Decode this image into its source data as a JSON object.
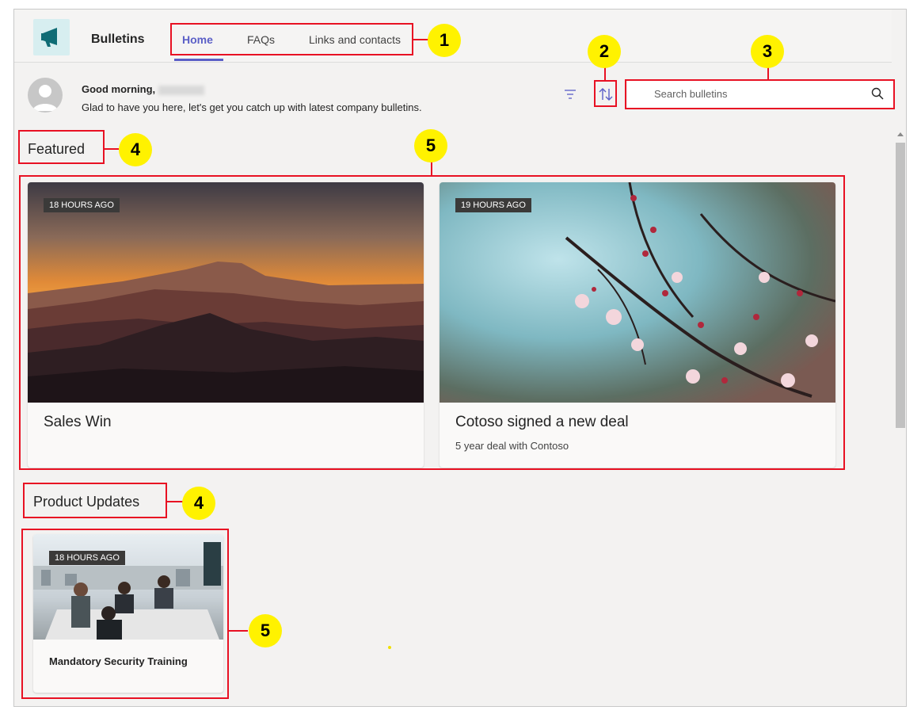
{
  "app": {
    "title": "Bulletins",
    "colors": {
      "accent": "#5b5fc7",
      "annotation": "#e81123",
      "callout": "#fff200"
    }
  },
  "tabs": [
    {
      "label": "Home",
      "active": true
    },
    {
      "label": "FAQs",
      "active": false
    },
    {
      "label": "Links and contacts",
      "active": false
    }
  ],
  "greeting": {
    "title": "Good morning,",
    "subtitle": "Glad to have you here, let's get you catch up with latest company bulletins."
  },
  "toolbar": {
    "filter_icon": "filter-icon",
    "sort_icon": "sort-icon"
  },
  "search": {
    "placeholder": "Search bulletins"
  },
  "sections": [
    {
      "title": "Featured",
      "cards": [
        {
          "badge": "18 HOURS AGO",
          "title": "Sales Win",
          "subtitle": ""
        },
        {
          "badge": "19 HOURS AGO",
          "title": "Cotoso signed a new deal",
          "subtitle": "5 year deal with Contoso"
        }
      ]
    },
    {
      "title": "Product Updates",
      "cards": [
        {
          "badge": "18 HOURS AGO",
          "title": "Mandatory Security Training",
          "subtitle": ""
        }
      ]
    }
  ],
  "callouts": {
    "c1": "1",
    "c2": "2",
    "c3": "3",
    "c4a": "4",
    "c4b": "4",
    "c5a": "5",
    "c5b": "5"
  }
}
